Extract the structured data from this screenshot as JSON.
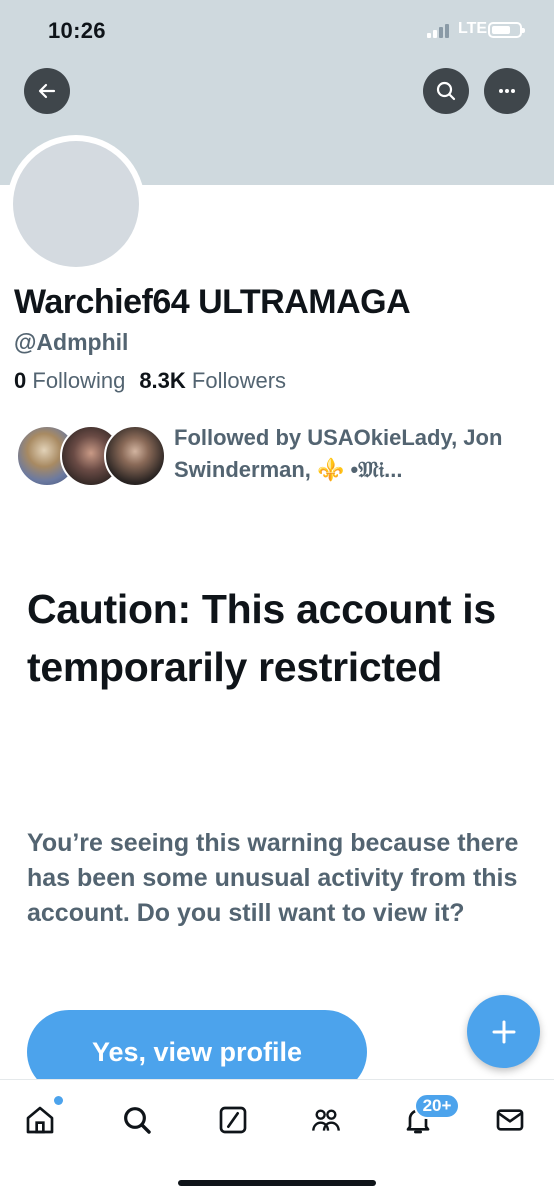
{
  "status_bar": {
    "time": "10:26",
    "network": "LTE"
  },
  "profile": {
    "display_name": "Warchief64 ULTRAMAGA",
    "handle": "@Admphil",
    "following_count": "0",
    "following_label": "Following",
    "followers_count": "8.3K",
    "followers_label": "Followers",
    "followed_by_text": "Followed by USAOkieLady, Jon Swinderman, ⚜️ •𝔐𝔦..."
  },
  "warning": {
    "title": "Caution: This account is temporarily restricted",
    "body": "You’re seeing this warning because there has been some unusual activity from this account. Do you still want to view it?",
    "button_label": "Yes, view profile"
  },
  "tab_bar": {
    "notifications_badge": "20+",
    "items": [
      "home-icon",
      "search-icon",
      "grok-icon",
      "communities-icon",
      "bell-icon",
      "mail-icon"
    ]
  },
  "colors": {
    "accent": "#4ca3ec",
    "banner": "#cfd9de",
    "secondary_text": "#536471",
    "primary_text": "#0f1419"
  }
}
